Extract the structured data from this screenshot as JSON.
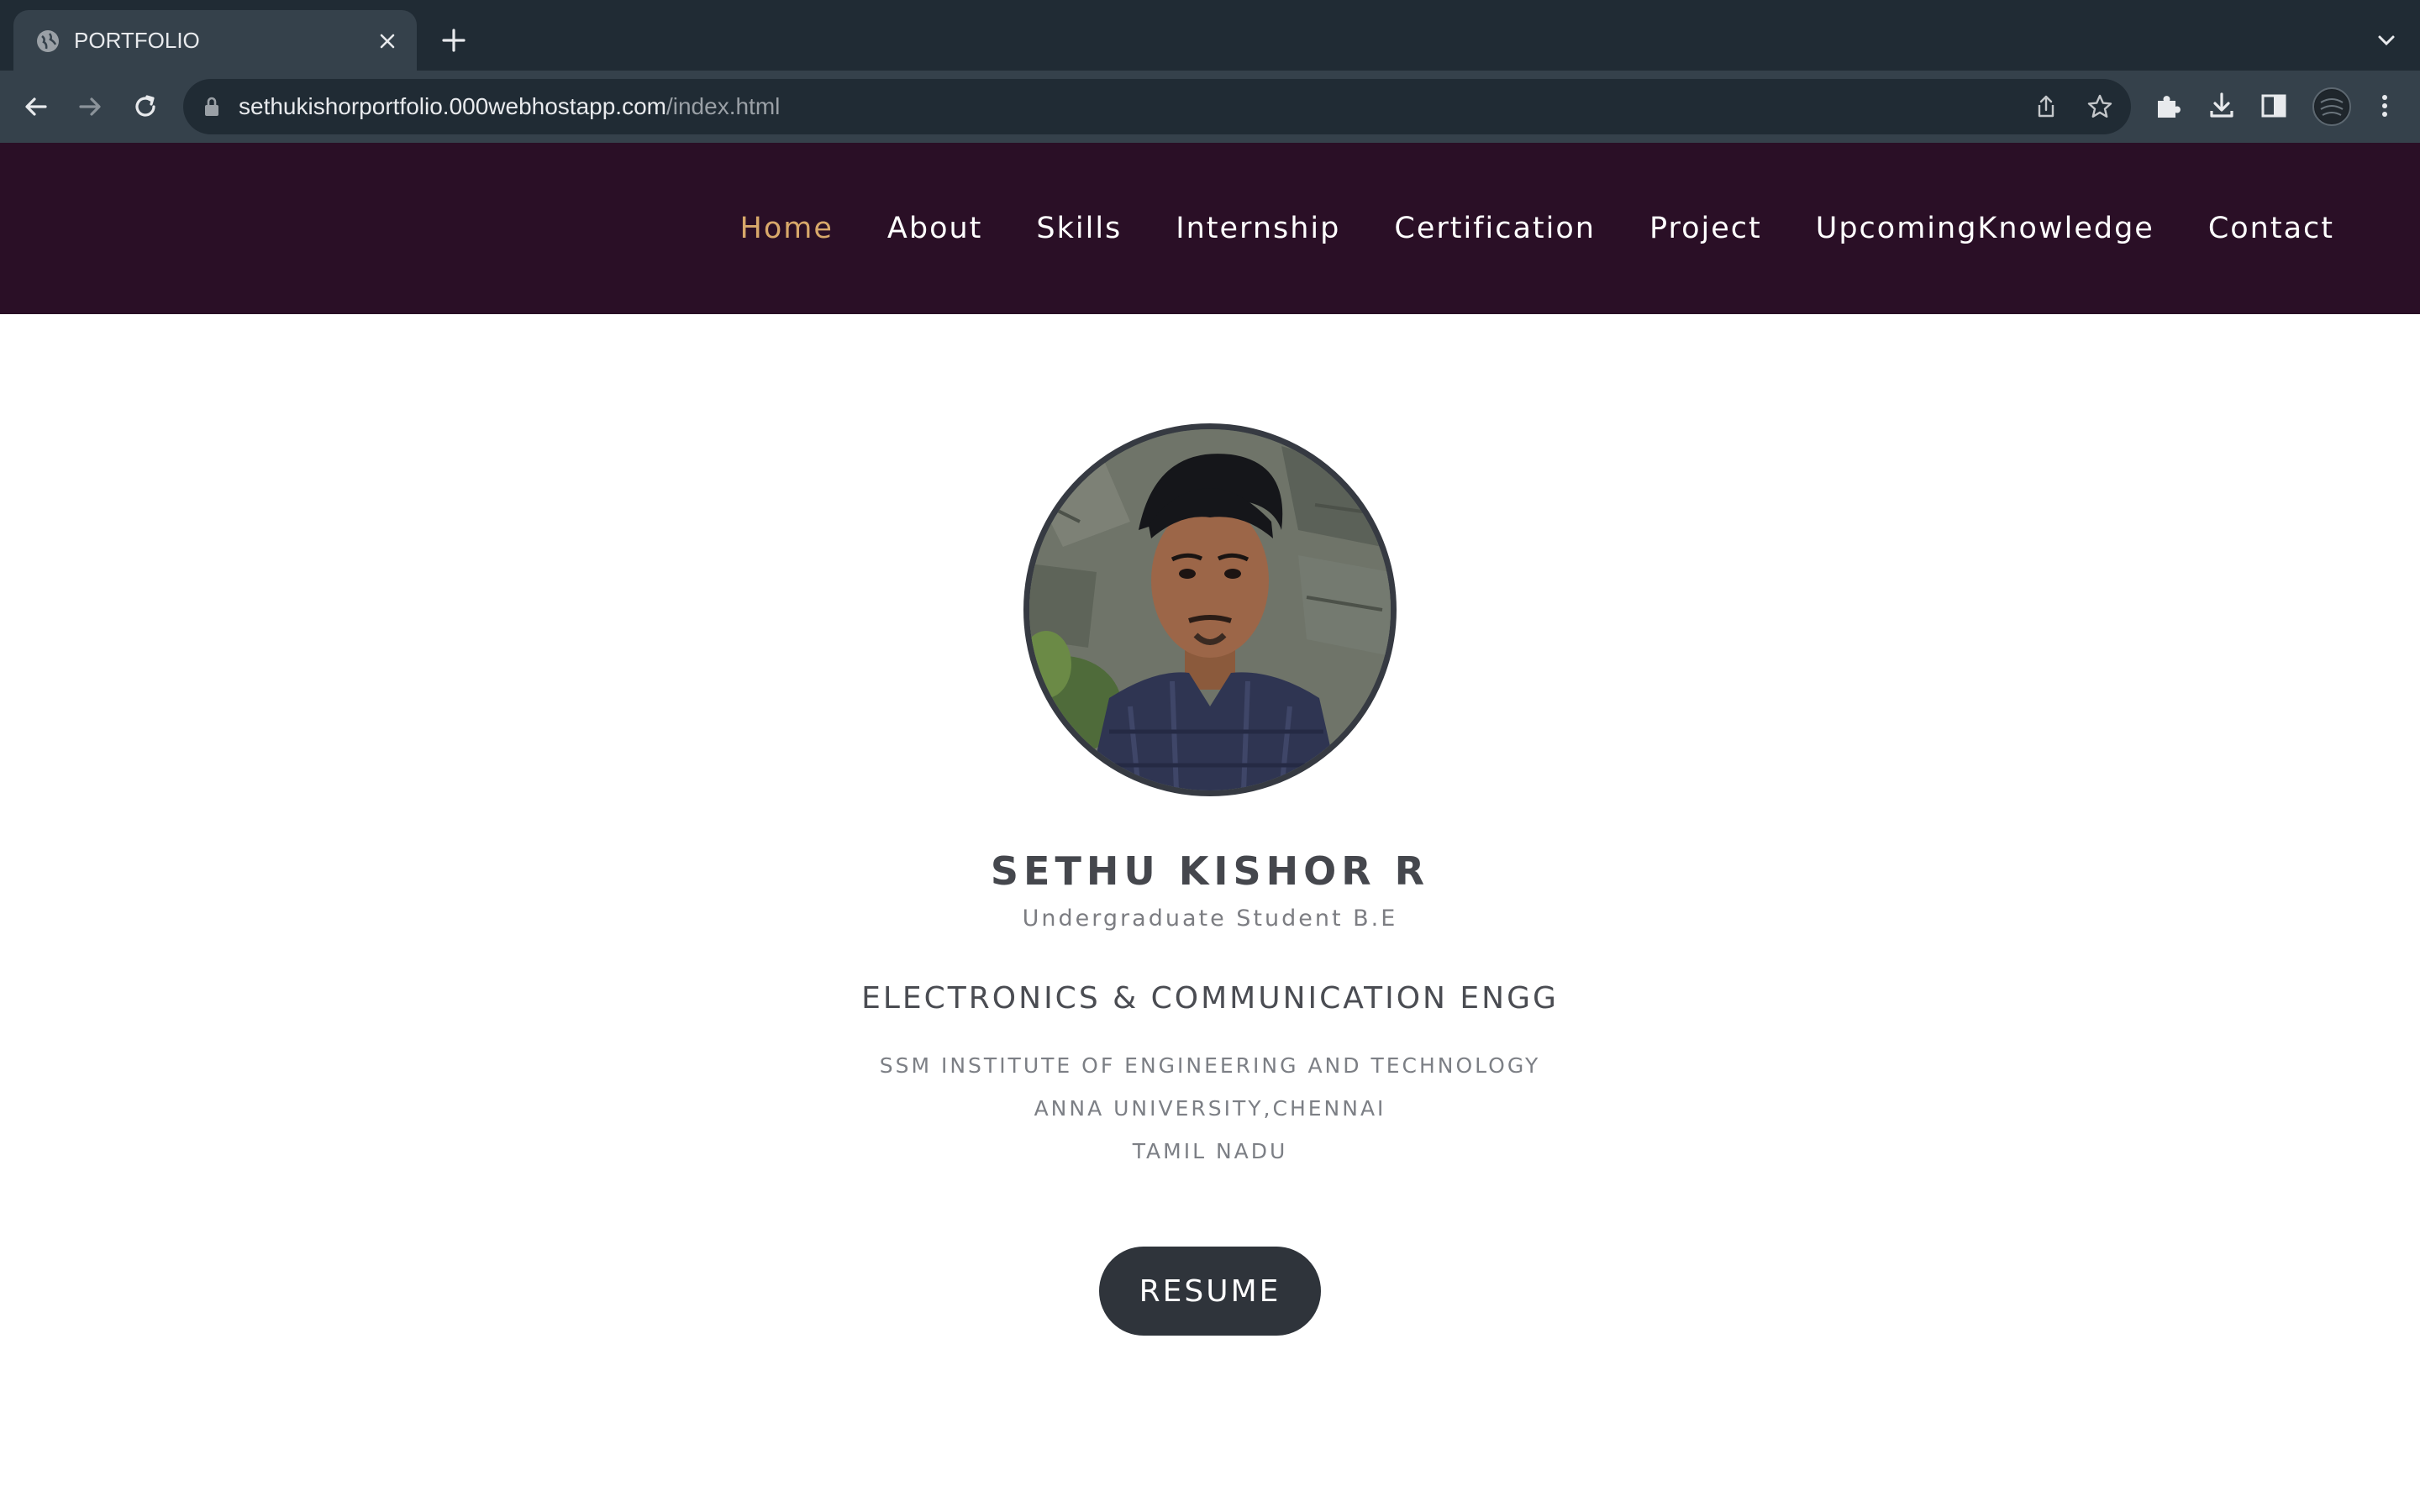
{
  "browser": {
    "tab_title": "PORTFOLIO",
    "url_host": "sethukishorportfolio.000webhostapp.com",
    "url_path": "/index.html"
  },
  "site": {
    "nav": [
      {
        "label": "Home",
        "active": true
      },
      {
        "label": "About",
        "active": false
      },
      {
        "label": "Skills",
        "active": false
      },
      {
        "label": "Internship",
        "active": false
      },
      {
        "label": "Certification",
        "active": false
      },
      {
        "label": "Project",
        "active": false
      },
      {
        "label": "UpcomingKnowledge",
        "active": false
      },
      {
        "label": "Contact",
        "active": false
      }
    ],
    "accent_color": "#d8a86a",
    "header_color": "#2a0f26"
  },
  "profile": {
    "name": "SETHU KISHOR R",
    "subtitle": "Undergraduate Student B.E",
    "department": "ELECTRONICS & COMMUNICATION ENGG",
    "institution_lines": [
      "SSM INSTITUTE OF ENGINEERING AND TECHNOLOGY",
      "ANNA UNIVERSITY,CHENNAI",
      "TAMIL NADU"
    ],
    "resume_label": "RESUME"
  }
}
